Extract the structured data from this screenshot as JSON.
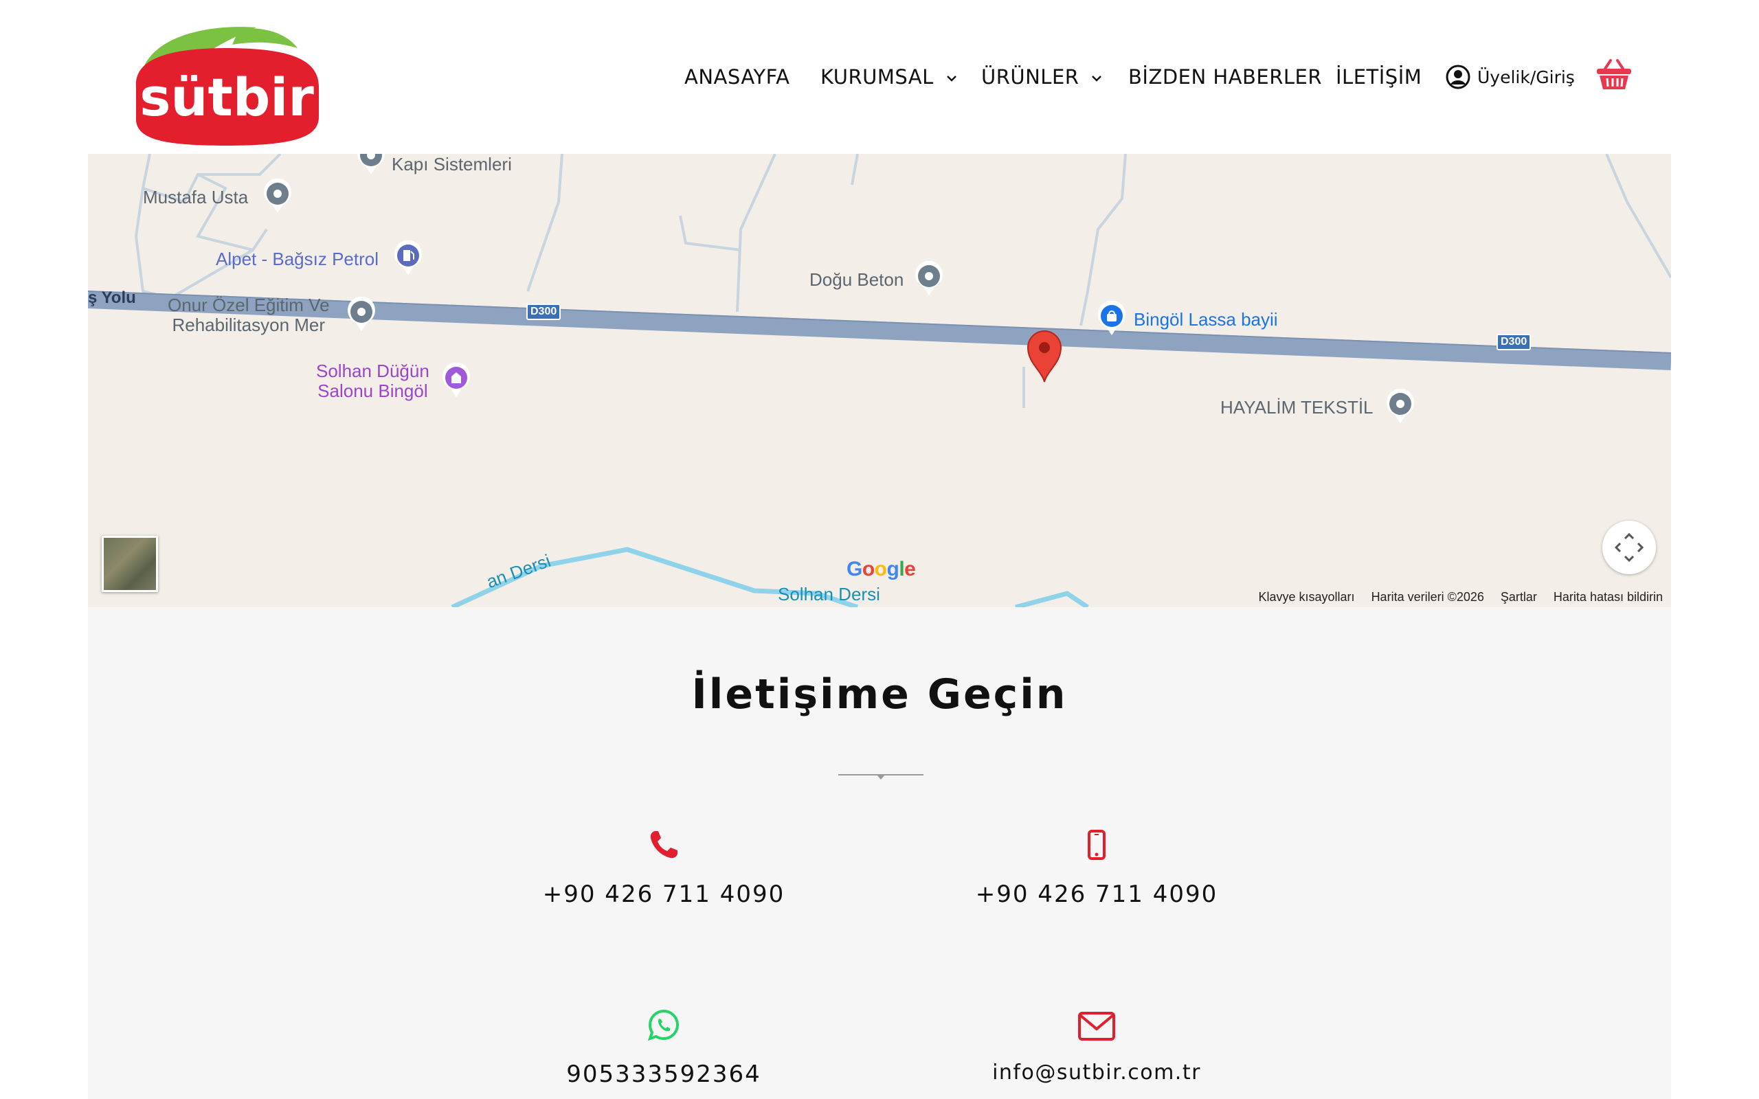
{
  "brand": {
    "logo_text": "sütbir",
    "colors": {
      "red": "#e31e2d",
      "green": "#7cc242"
    }
  },
  "nav": {
    "items": [
      {
        "label": "ANASAYFA",
        "has_dropdown": false
      },
      {
        "label": "KURUMSAL",
        "has_dropdown": true
      },
      {
        "label": "ÜRÜNLER",
        "has_dropdown": true
      },
      {
        "label": "BİZDEN HABERLER",
        "has_dropdown": false
      },
      {
        "label": "İLETİŞİM",
        "has_dropdown": false
      }
    ],
    "account_label": "Üyelik/Giriş",
    "account_icon": "user-circle-icon",
    "cart_icon": "basket-icon"
  },
  "map": {
    "pois": [
      {
        "label": "Kapı Sistemleri",
        "icon": "place-pin-icon"
      },
      {
        "label": "Mustafa Usta",
        "icon": "place-pin-icon"
      },
      {
        "label": "Alpet - Bağsız Petrol",
        "icon": "gas-station-icon"
      },
      {
        "label": "Doğu Beton",
        "icon": "place-pin-icon"
      },
      {
        "label": "Bingöl Lassa bayii",
        "icon": "shopping-bag-icon"
      },
      {
        "label_line1": "Onur Özel Eğitim Ve",
        "label_line2": "Rehabilitasyon Mer",
        "icon": "place-pin-icon"
      },
      {
        "label_line1": "Solhan Düğün",
        "label_line2": "Salonu Bingöl",
        "icon": "event-venue-icon"
      },
      {
        "label": "HAYALİM TEKSTİL",
        "icon": "place-pin-icon"
      }
    ],
    "road_name": "ş Yolu",
    "road_badge": "D300",
    "rivers": [
      "Solhan Dersi",
      "an Dersi"
    ],
    "google_word": "Google",
    "footer": {
      "shortcuts": "Klavye kısayolları",
      "data": "Harita verileri ©2026",
      "terms": "Şartlar",
      "report": "Harita hatası bildirin"
    }
  },
  "contact": {
    "title": "İletişime Geçin",
    "phone": "+90 426 711 4090",
    "mobile": "+90 426 711 4090",
    "whatsapp": "905333592364",
    "email": "info@sutbir.com.tr",
    "accent": "#e31e2d",
    "whatsapp_color": "#25d366"
  }
}
